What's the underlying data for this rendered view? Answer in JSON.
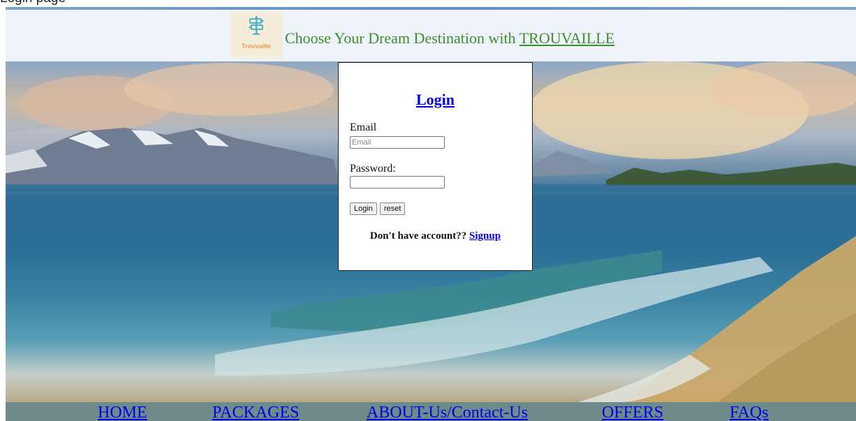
{
  "window": {
    "caption": "Login page"
  },
  "header": {
    "logo_text": "Trouvaille",
    "title_prefix": "Choose Your Dream Destination with ",
    "title_link": "TROUVAILLE"
  },
  "login": {
    "title": "Login",
    "email_label": "Email",
    "email_placeholder": "Email",
    "email_value": "",
    "password_label": "Password:",
    "password_value": "",
    "login_button": "Login",
    "reset_button": "reset",
    "no_account_text": "Don't have account?? ",
    "signup_link": "Signup"
  },
  "nav": {
    "items": [
      {
        "label": "HOME"
      },
      {
        "label": "PACKAGES"
      },
      {
        "label": "ABOUT-Us/Contact-Us"
      },
      {
        "label": "OFFERS"
      },
      {
        "label": "FAQs"
      }
    ]
  },
  "colors": {
    "link": "#0000ee",
    "header_title": "#3e8e2e",
    "header_bg": "#eef3fa",
    "nav_bg": "#6e8b8a",
    "logo_accent": "#e8a04a",
    "logo_icon": "#4fb3c9"
  },
  "icons": {
    "logo": "signpost-icon"
  }
}
